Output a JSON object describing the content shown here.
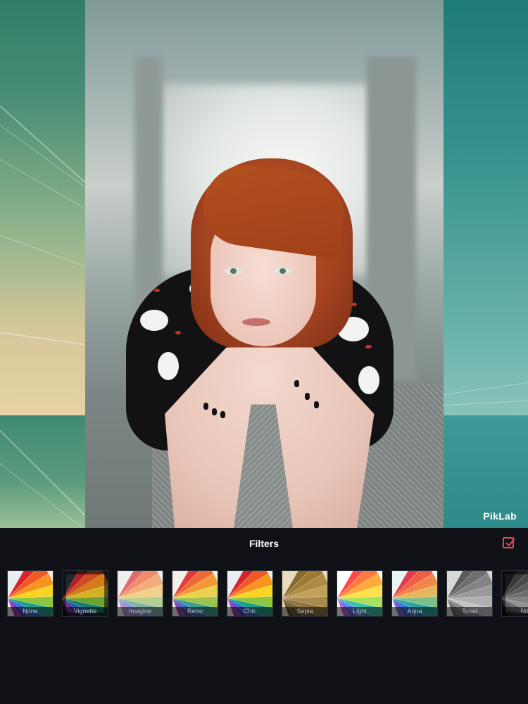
{
  "watermark": "PikLab",
  "panel": {
    "title": "Filters",
    "confirm_icon": "check-square-icon",
    "accent": "#e04a55"
  },
  "filters": [
    {
      "label": "None",
      "tone": "color"
    },
    {
      "label": "Vignette",
      "tone": "vignette"
    },
    {
      "label": "Imagine",
      "tone": "soft"
    },
    {
      "label": "Retro",
      "tone": "retro"
    },
    {
      "label": "Chic",
      "tone": "color"
    },
    {
      "label": "Sepia",
      "tone": "sepia"
    },
    {
      "label": "Light",
      "tone": "light"
    },
    {
      "label": "Aqua",
      "tone": "aqua"
    },
    {
      "label": "Tonal",
      "tone": "gray"
    },
    {
      "label": "No",
      "tone": "dark"
    }
  ]
}
